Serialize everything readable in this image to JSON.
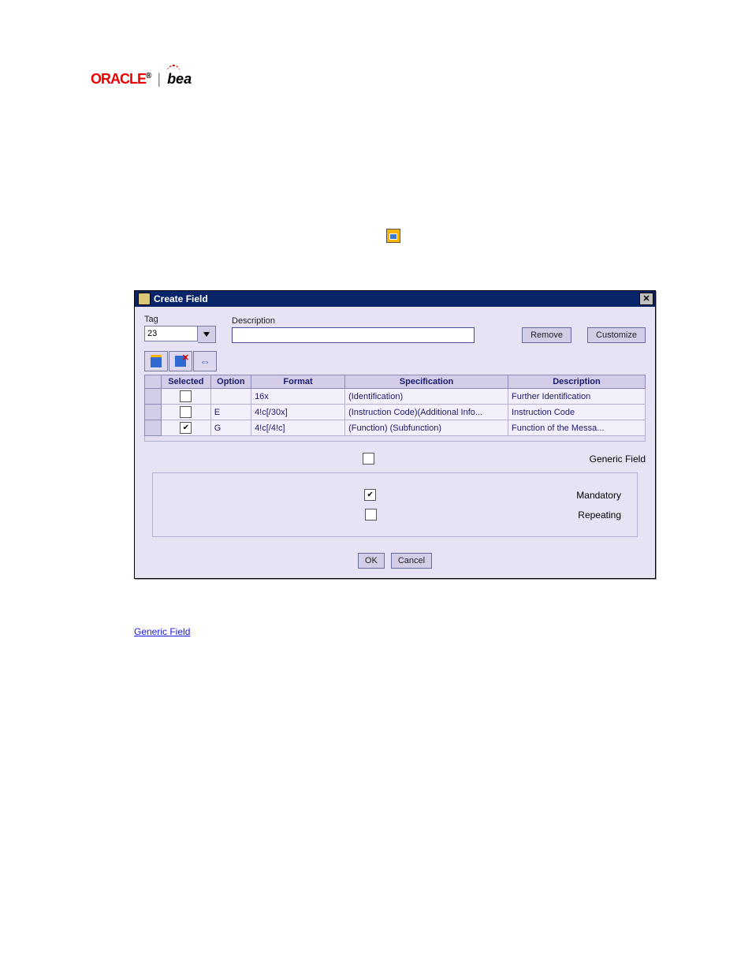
{
  "logos": {
    "oracle": "ORACLE",
    "separator": "|",
    "bea": "bea"
  },
  "intro_icon_alt": "add-field",
  "dialog": {
    "title": "Create Field",
    "tag_label": "Tag",
    "tag_value": "23",
    "desc_label": "Description",
    "desc_value": "",
    "remove_btn": "Remove",
    "customize_btn": "Customize",
    "columns": [
      "",
      "Selected",
      "Option",
      "Format",
      "Specification",
      "Description"
    ],
    "rows": [
      {
        "selected": false,
        "option": "",
        "format": "16x",
        "spec": "(Identification)",
        "desc": "Further Identification"
      },
      {
        "selected": false,
        "option": "E",
        "format": "4!c[/30x]",
        "spec": "(Instruction Code)(Additional Info...",
        "desc": "Instruction Code"
      },
      {
        "selected": true,
        "option": "G",
        "format": "4!c[/4!c]",
        "spec": "(Function) (Subfunction)",
        "desc": "Function of the Messa..."
      }
    ],
    "generic_label": "Generic Field",
    "generic_checked": false,
    "mandatory_label": "Mandatory",
    "mandatory_checked": true,
    "repeating_label": "Repeating",
    "repeating_checked": false,
    "ok_btn": "OK",
    "cancel_btn": "Cancel"
  },
  "link_text": "Generic Field"
}
